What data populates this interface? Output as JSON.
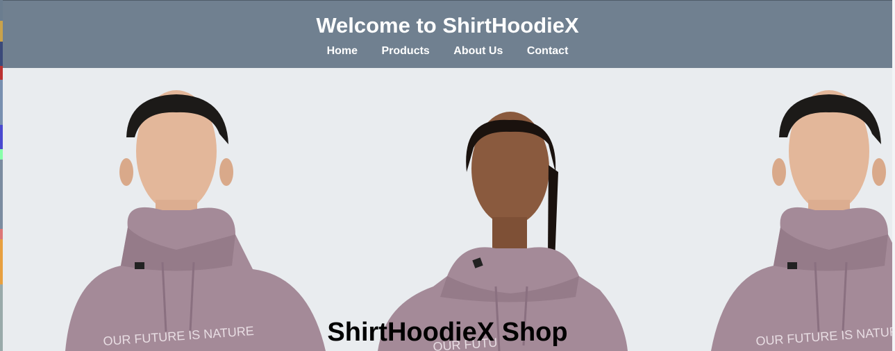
{
  "header": {
    "title": "Welcome to ShirtHoodieX"
  },
  "nav": {
    "items": [
      "Home",
      "Products",
      "About Us",
      "Contact"
    ]
  },
  "hero": {
    "title": "ShirtHoodieX Shop",
    "hoodie_print_left": "OUR FUTURE IS NATURE",
    "hoodie_print_center": "OUR FUTU",
    "hoodie_print_right": "OUR FUTURE IS NATURE"
  },
  "colors": {
    "header_bg": "#708090",
    "hero_bg": "#e9ecef",
    "hoodie": "#a48a98"
  }
}
